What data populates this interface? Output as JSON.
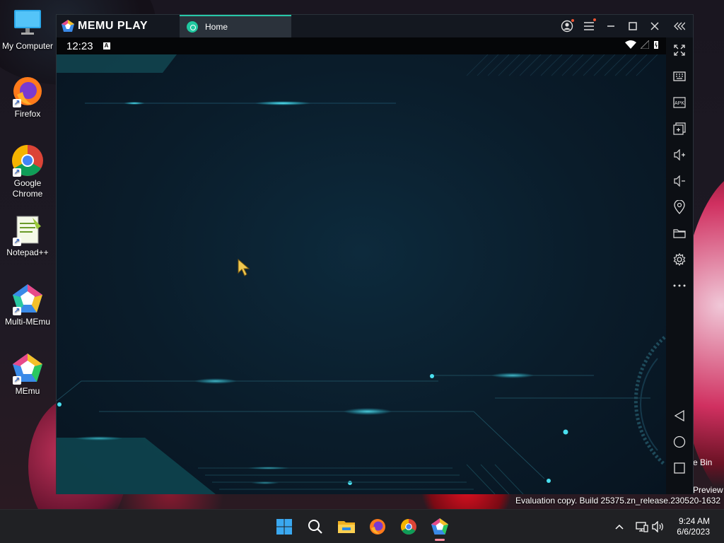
{
  "desktop": {
    "icons": [
      {
        "label": "My Computer",
        "icon": "monitor-icon"
      },
      {
        "label": "Firefox",
        "icon": "firefox-icon"
      },
      {
        "label": "Google\nChrome",
        "icon": "chrome-icon"
      },
      {
        "label": "Notepad++",
        "icon": "notepadpp-icon"
      },
      {
        "label": "Multi-MEmu",
        "icon": "multi-memu-icon"
      },
      {
        "label": "MEmu",
        "icon": "memu-icon"
      }
    ],
    "recycle_bin_label": "e Bin",
    "preview_label": "Preview",
    "evaluation_text": "Evaluation copy. Build 25375.zn_release.230520-1632"
  },
  "memu": {
    "brand": "MEMU PLAY",
    "tab_label": "Home",
    "status_time": "12:23",
    "title_buttons": [
      "account-icon",
      "menu-icon",
      "minimize-icon",
      "maximize-icon",
      "close-icon",
      "collapse-sidebar-icon"
    ],
    "sidebar_tools": [
      "fullscreen-icon",
      "keyboard-icon",
      "apk-icon",
      "multi-window-icon",
      "volume-up-icon",
      "volume-down-icon",
      "location-icon",
      "folder-icon",
      "settings-icon",
      "more-icon"
    ],
    "nav_buttons": [
      "back-icon",
      "home-icon",
      "recents-icon"
    ],
    "apk_label": "APK"
  },
  "taskbar": {
    "apps": [
      "start-icon",
      "search-icon",
      "file-explorer-icon",
      "firefox-icon",
      "chrome-icon",
      "memu-icon"
    ],
    "tray": [
      "chevron-up-icon",
      "network-icon",
      "speaker-icon"
    ],
    "time": "9:24 AM",
    "date": "6/6/2023"
  },
  "colors": {
    "accent": "#28c8a8",
    "screen_glow": "#2ad6f0"
  }
}
